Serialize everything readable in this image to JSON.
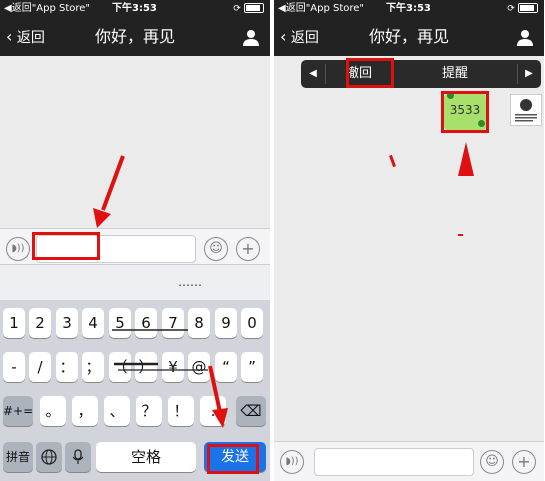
{
  "statusbar": {
    "back_app": "◀返回\"App Store\"",
    "time": "下午3:53"
  },
  "nav": {
    "back_label": "返回",
    "title": "你好，再见"
  },
  "keyboard": {
    "suggestion_dots": "……",
    "row1": [
      "1",
      "2",
      "3",
      "4",
      "5",
      "6",
      "7",
      "8",
      "9",
      "0"
    ],
    "row2": [
      "-",
      "/",
      "：",
      "；",
      "（",
      "）",
      "¥",
      "@",
      "“",
      "”"
    ],
    "row3_left": "#+=",
    "row3": [
      "。",
      "，",
      "、",
      "？",
      "！",
      "."
    ],
    "delete_icon": "⌫",
    "bottom": {
      "pinyin": "拼音",
      "space": "空格",
      "send": "发送"
    }
  },
  "context_menu": {
    "left_arrow": "◀",
    "recall": "撤回",
    "remind": "提醒",
    "right_arrow": "▶"
  },
  "message": {
    "text": "3533"
  },
  "colors": {
    "annotation_red": "#e01010",
    "bubble_green": "#a7e06b",
    "send_blue": "#1a73e8"
  }
}
